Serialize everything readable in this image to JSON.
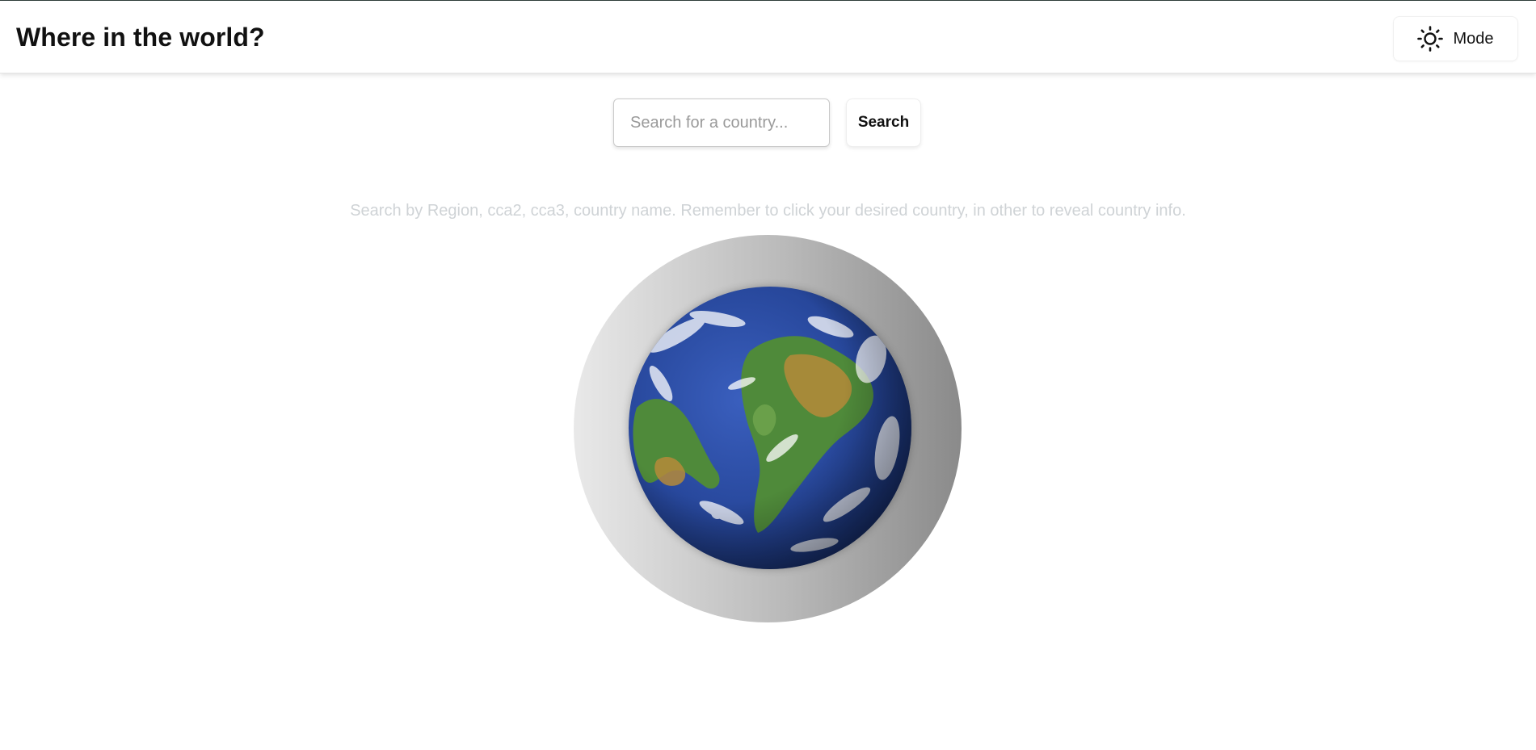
{
  "header": {
    "title": "Where in the world?",
    "mode_label": "Mode",
    "mode_icon": "sun-icon"
  },
  "search": {
    "placeholder": "Search for a country...",
    "value": "",
    "button_label": "Search"
  },
  "hint": "Search by Region, cca2, cca3, country name. Remember to click your desired country, in other to reveal country info.",
  "colors": {
    "hint_text": "#cfd3d6",
    "ocean": "#27479b",
    "land": "#4f8a3a",
    "desert": "#b58a3a"
  }
}
